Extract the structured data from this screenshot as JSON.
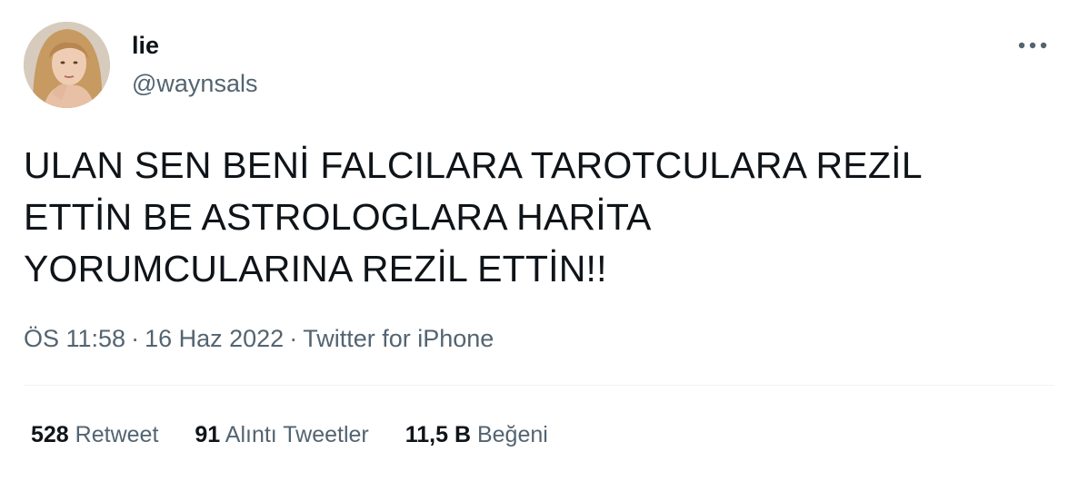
{
  "author": {
    "name": "lie",
    "handle": "@waynsals"
  },
  "tweet": {
    "text": "ULAN SEN BENİ FALCILARA TAROTCULARA REZİL\nETTİN BE ASTROLOGLARA HARİTA\nYORUMCULARINA REZİL ETTİN!!",
    "time": "ÖS 11:58",
    "date": "16 Haz 2022",
    "source": "Twitter for iPhone",
    "separator": "·"
  },
  "stats": {
    "retweets": {
      "count": "528",
      "label": "Retweet"
    },
    "quotes": {
      "count": "91",
      "label": "Alıntı Tweetler"
    },
    "likes": {
      "count": "11,5 B",
      "label": "Beğeni"
    }
  },
  "icons": {
    "more": "more-horizontal-icon",
    "avatar": "profile-photo"
  },
  "colors": {
    "text_primary": "#0f1419",
    "text_secondary": "#536471",
    "divider": "#eff3f4"
  }
}
